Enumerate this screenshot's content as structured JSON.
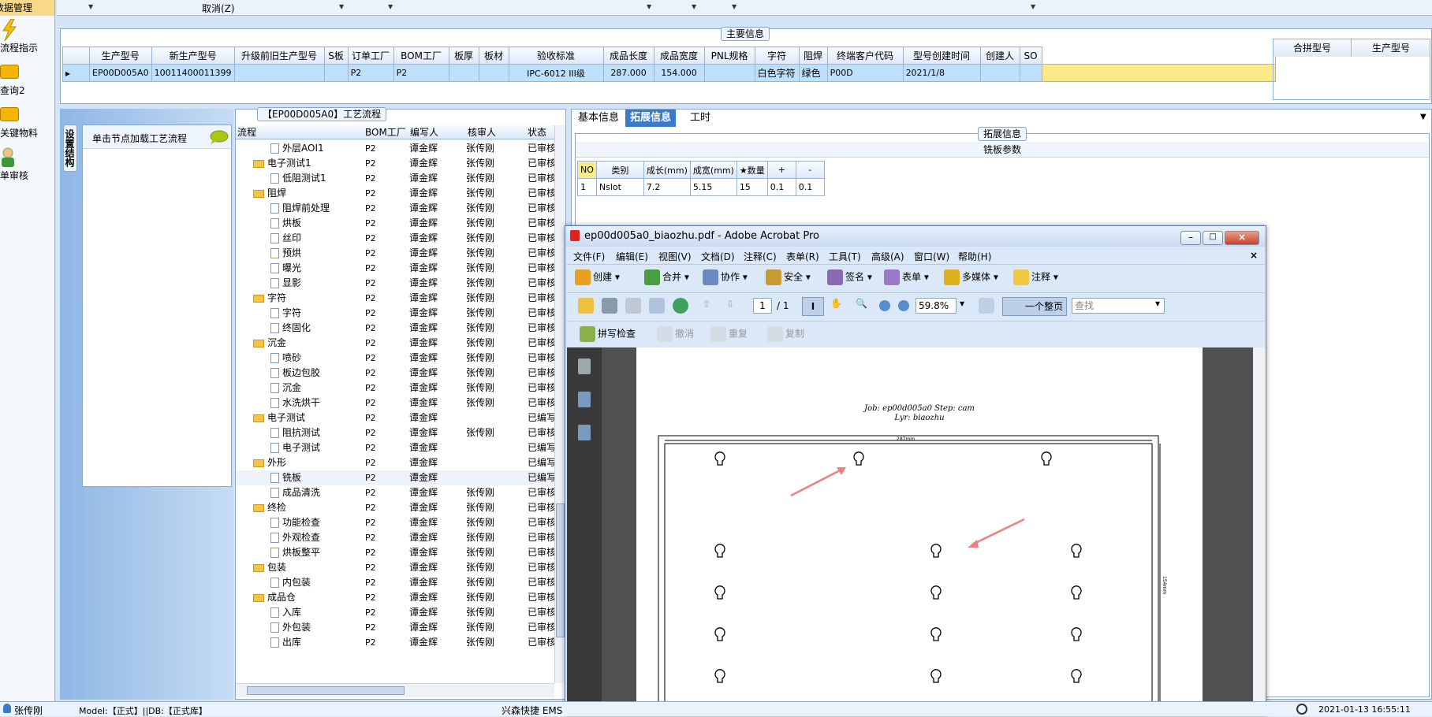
{
  "nav": {
    "header": "数据管理",
    "items": [
      {
        "label": "流程指示",
        "color": "#f4c200"
      },
      {
        "label": "查询2",
        "color": "#f4b400"
      },
      {
        "label": "关键物料",
        "color": "#f4b400"
      },
      {
        "label": "单审核",
        "color": "#3a9a3a"
      }
    ]
  },
  "topbar": {
    "cancel": "取消(Z)"
  },
  "main": {
    "caption": "主要信息",
    "headers": [
      "生产型号",
      "新生产型号",
      "升级前旧生产型号",
      "S板",
      "订单工厂",
      "BOM工厂",
      "板厚",
      "板材",
      "验收标准",
      "成品长度",
      "成品宽度",
      "PNL规格",
      "字符",
      "阻焊",
      "终端客户代码",
      "型号创建时间",
      "创建人",
      "SO"
    ],
    "row": [
      "EP00D005A0",
      "10011400011399",
      "",
      "",
      "P2",
      "P2",
      "",
      "",
      "IPC-6012 III级",
      "287.000",
      "154.000",
      "",
      "白色字符",
      "绿色",
      "P00D",
      "2021/1/8",
      "",
      ""
    ],
    "right_headers": [
      "合拼型号",
      "生产型号"
    ]
  },
  "left": {
    "vtab": "设置结构",
    "hint": "单击节点加载工艺流程"
  },
  "flow": {
    "title": "【EP00D005A0】工艺流程",
    "headers": [
      "流程",
      "BOM工厂",
      "编写人",
      "核审人",
      "状态"
    ],
    "rows": [
      {
        "name": "外层AOI1",
        "lvl": 1,
        "f": "P2",
        "w": "谭金辉",
        "r": "张传刚",
        "s": "已审核"
      },
      {
        "name": "电子测试1",
        "lvl": 0,
        "f": "P2",
        "w": "谭金辉",
        "r": "张传刚",
        "s": "已审核"
      },
      {
        "name": "低阻测试1",
        "lvl": 1,
        "f": "P2",
        "w": "谭金辉",
        "r": "张传刚",
        "s": "已审核"
      },
      {
        "name": "阻焊",
        "lvl": 0,
        "f": "P2",
        "w": "谭金辉",
        "r": "张传刚",
        "s": "已审核"
      },
      {
        "name": "阻焊前处理",
        "lvl": 1,
        "f": "P2",
        "w": "谭金辉",
        "r": "张传刚",
        "s": "已审核"
      },
      {
        "name": "烘板",
        "lvl": 1,
        "f": "P2",
        "w": "谭金辉",
        "r": "张传刚",
        "s": "已审核"
      },
      {
        "name": "丝印",
        "lvl": 1,
        "f": "P2",
        "w": "谭金辉",
        "r": "张传刚",
        "s": "已审核"
      },
      {
        "name": "预烘",
        "lvl": 1,
        "f": "P2",
        "w": "谭金辉",
        "r": "张传刚",
        "s": "已审核"
      },
      {
        "name": "曝光",
        "lvl": 1,
        "f": "P2",
        "w": "谭金辉",
        "r": "张传刚",
        "s": "已审核"
      },
      {
        "name": "显影",
        "lvl": 1,
        "f": "P2",
        "w": "谭金辉",
        "r": "张传刚",
        "s": "已审核"
      },
      {
        "name": "字符",
        "lvl": 0,
        "f": "P2",
        "w": "谭金辉",
        "r": "张传刚",
        "s": "已审核"
      },
      {
        "name": "字符",
        "lvl": 1,
        "f": "P2",
        "w": "谭金辉",
        "r": "张传刚",
        "s": "已审核"
      },
      {
        "name": "终固化",
        "lvl": 1,
        "f": "P2",
        "w": "谭金辉",
        "r": "张传刚",
        "s": "已审核"
      },
      {
        "name": "沉金",
        "lvl": 0,
        "f": "P2",
        "w": "谭金辉",
        "r": "张传刚",
        "s": "已审核"
      },
      {
        "name": "喷砂",
        "lvl": 1,
        "f": "P2",
        "w": "谭金辉",
        "r": "张传刚",
        "s": "已审核"
      },
      {
        "name": "板边包胶",
        "lvl": 1,
        "f": "P2",
        "w": "谭金辉",
        "r": "张传刚",
        "s": "已审核"
      },
      {
        "name": "沉金",
        "lvl": 1,
        "f": "P2",
        "w": "谭金辉",
        "r": "张传刚",
        "s": "已审核"
      },
      {
        "name": "水洗烘干",
        "lvl": 1,
        "f": "P2",
        "w": "谭金辉",
        "r": "张传刚",
        "s": "已审核"
      },
      {
        "name": "电子测试",
        "lvl": 0,
        "f": "P2",
        "w": "谭金辉",
        "r": "",
        "s": "已编写"
      },
      {
        "name": "阻抗测试",
        "lvl": 1,
        "f": "P2",
        "w": "谭金辉",
        "r": "张传刚",
        "s": "已审核"
      },
      {
        "name": "电子测试",
        "lvl": 1,
        "f": "P2",
        "w": "谭金辉",
        "r": "",
        "s": "已编写"
      },
      {
        "name": "外形",
        "lvl": 0,
        "f": "P2",
        "w": "谭金辉",
        "r": "",
        "s": "已编写"
      },
      {
        "name": "铣板",
        "lvl": 1,
        "f": "P2",
        "w": "谭金辉",
        "r": "",
        "s": "已编写"
      },
      {
        "name": "成品清洗",
        "lvl": 1,
        "f": "P2",
        "w": "谭金辉",
        "r": "张传刚",
        "s": "已审核"
      },
      {
        "name": "终检",
        "lvl": 0,
        "f": "P2",
        "w": "谭金辉",
        "r": "张传刚",
        "s": "已审核"
      },
      {
        "name": "功能检查",
        "lvl": 1,
        "f": "P2",
        "w": "谭金辉",
        "r": "张传刚",
        "s": "已审核"
      },
      {
        "name": "外观检查",
        "lvl": 1,
        "f": "P2",
        "w": "谭金辉",
        "r": "张传刚",
        "s": "已审核"
      },
      {
        "name": "烘板整平",
        "lvl": 1,
        "f": "P2",
        "w": "谭金辉",
        "r": "张传刚",
        "s": "已审核"
      },
      {
        "name": "包装",
        "lvl": 0,
        "f": "P2",
        "w": "谭金辉",
        "r": "张传刚",
        "s": "已审核"
      },
      {
        "name": "内包装",
        "lvl": 1,
        "f": "P2",
        "w": "谭金辉",
        "r": "张传刚",
        "s": "已审核"
      },
      {
        "name": "成品仓",
        "lvl": 0,
        "f": "P2",
        "w": "谭金辉",
        "r": "张传刚",
        "s": "已审核"
      },
      {
        "name": "入库",
        "lvl": 1,
        "f": "P2",
        "w": "谭金辉",
        "r": "张传刚",
        "s": "已审核"
      },
      {
        "name": "外包装",
        "lvl": 1,
        "f": "P2",
        "w": "谭金辉",
        "r": "张传刚",
        "s": "已审核"
      },
      {
        "name": "出库",
        "lvl": 1,
        "f": "P2",
        "w": "谭金辉",
        "r": "张传刚",
        "s": "已审核"
      }
    ]
  },
  "right": {
    "tabs": [
      "基本信息",
      "拓展信息",
      "工时"
    ],
    "caption": "拓展信息",
    "section": "铣板参数",
    "headers": [
      "NO",
      "类别",
      "成长(mm)",
      "成宽(mm)",
      "★数量",
      "+",
      "-"
    ],
    "row": [
      "1",
      "Nslot",
      "7.2",
      "5.15",
      "15",
      "0.1",
      "0.1"
    ]
  },
  "acrobat": {
    "title": "ep00d005a0_biaozhu.pdf - Adobe Acrobat Pro",
    "menu": [
      "文件(F)",
      "编辑(E)",
      "视图(V)",
      "文档(D)",
      "注释(C)",
      "表单(R)",
      "工具(T)",
      "高级(A)",
      "窗口(W)",
      "帮助(H)"
    ],
    "toolbar1": [
      "创建",
      "合并",
      "协作",
      "安全",
      "签名",
      "表单",
      "多媒体",
      "注释"
    ],
    "page": "1",
    "pages": "/ 1",
    "zoom": "59.8%",
    "fit": "一个整页",
    "search_placeholder": "查找",
    "toolbar3": [
      "拼写检查",
      "撤消",
      "重复",
      "复制"
    ],
    "doc_line1": "Job: ep00d005a0  Step: cam",
    "doc_line2": "Lyr: biaozhu",
    "dim_w": "287mm",
    "dim_h": "154mm"
  },
  "status": {
    "user": "张传刚",
    "model": "Model:【正式】||DB:【正式库】",
    "company": "兴森快捷 EMS",
    "time": "2021-01-13 16:55:11"
  }
}
